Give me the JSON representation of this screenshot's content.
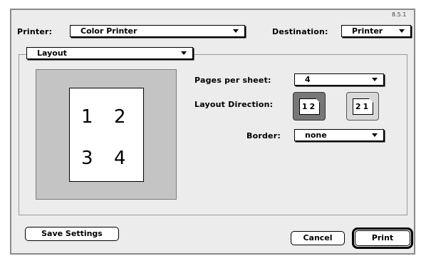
{
  "version": "8.5.1",
  "printer": {
    "label": "Printer:",
    "value": "Color Printer"
  },
  "destination": {
    "label": "Destination:",
    "value": "Printer"
  },
  "panel": {
    "value": "Layout"
  },
  "preview": {
    "numbers": [
      "1",
      "2",
      "3",
      "4"
    ]
  },
  "pages_per_sheet": {
    "label": "Pages per sheet:",
    "value": "4"
  },
  "layout_direction": {
    "label": "Layout Direction:",
    "options": [
      {
        "text": "12",
        "selected": true
      },
      {
        "text": "21",
        "selected": false
      }
    ]
  },
  "border": {
    "label": "Border:",
    "value": "none"
  },
  "buttons": {
    "save_settings": "Save Settings",
    "cancel": "Cancel",
    "print": "Print"
  }
}
